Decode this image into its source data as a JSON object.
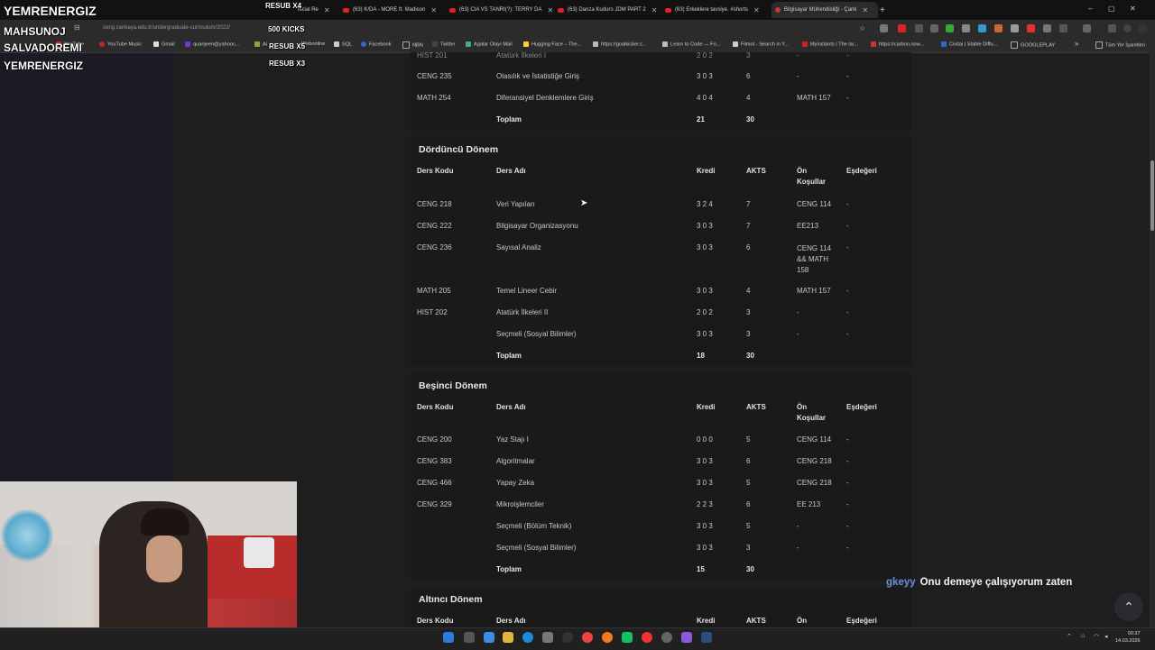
{
  "browser": {
    "tabs": [
      {
        "label": "fficial Re",
        "icon": "youtube-icon"
      },
      {
        "label": "(63) K/DA - MORE ft. Madison",
        "icon": "youtube-icon"
      },
      {
        "label": "(63) CIA VS TANRI(?): TERRY DA",
        "icon": "youtube-icon"
      },
      {
        "label": "(63) Danza Kuduro JDM PART 2",
        "icon": "youtube-icon"
      },
      {
        "label": "(63) Erkeklere tavsiye. #shorts",
        "icon": "youtube-icon"
      },
      {
        "label": "Bilgisayar Mühendisliği - Çank",
        "icon": "university-icon"
      }
    ],
    "address": "ceng.cankaya.edu.tr/undergraduate-curriculum/2022/",
    "bookmarks": [
      "YouTube",
      "YouTube Music",
      "Gmail",
      "quanjeen@yahooc...",
      "Ai",
      "Webonline",
      "SQL",
      "Facebook",
      "NBN",
      "Twitter",
      "Agalar Olayı Mail",
      "Hugging Face – The...",
      "https://goalkicker.c...",
      "Learn to Code — Fo...",
      "Filmot - Search in Y...",
      "Myinstants | The lar...",
      "https://carbon.now...",
      "Civitai | Stable Diffu...",
      "GOOGLEPLAY"
    ],
    "bookmarks_more": "»",
    "all_bookmarks": "Tüm Yer İşaretleri"
  },
  "overlay": {
    "main_name": "YEMRENERGIZ",
    "names": [
      "MAHSUNOJ",
      "SALVADOREMI",
      "YEMRENERGIZ"
    ],
    "labels": [
      "RESUB X4",
      "500 KICKS",
      "RESUB X5",
      "RESUB X3"
    ]
  },
  "curriculum": {
    "headers": {
      "code": "Ders Kodu",
      "name": "Ders Adı",
      "credit": "Kredi",
      "ects": "AKTS",
      "prereq": "Ön Koşullar",
      "equiv": "Eşdeğeri"
    },
    "prereq_cut": "Ön",
    "total_label": "Toplam",
    "third": {
      "rows": [
        {
          "code": "HIST 201",
          "name": "Atatürk İlkeleri I",
          "credit": "2 0 2",
          "ects": "3",
          "prereq": "-",
          "equiv": "-"
        },
        {
          "code": "CENG 235",
          "name": "Olasılık ve İstatistiğe Giriş",
          "credit": "3 0 3",
          "ects": "6",
          "prereq": "-",
          "equiv": "-"
        },
        {
          "code": "MATH 254",
          "name": "Diferansiyel Denklemlere Giriş",
          "credit": "4 0 4",
          "ects": "4",
          "prereq": "MATH 157",
          "equiv": "-"
        }
      ],
      "total_credit": "21",
      "total_ects": "30"
    },
    "fourth": {
      "title": "Dördüncü Dönem",
      "rows": [
        {
          "code": "CENG 218",
          "name": "Veri Yapıları",
          "credit": "3 2 4",
          "ects": "7",
          "prereq": "CENG 114",
          "equiv": "-"
        },
        {
          "code": "CENG 222",
          "name": "Bilgisayar Organizasyonu",
          "credit": "3 0 3",
          "ects": "7",
          "prereq": "EE213",
          "equiv": "-"
        },
        {
          "code": "CENG 236",
          "name": "Sayısal Analiz",
          "credit": "3 0 3",
          "ects": "6",
          "prereq": "CENG 114 && MATH 158",
          "equiv": "-"
        },
        {
          "code": "MATH 205",
          "name": "Temel Lineer Cebir",
          "credit": "3 0 3",
          "ects": "4",
          "prereq": "MATH 157",
          "equiv": "-"
        },
        {
          "code": "HIST 202",
          "name": "Atatürk İlkeleri II",
          "credit": "2 0 2",
          "ects": "3",
          "prereq": "-",
          "equiv": "-"
        },
        {
          "code": "",
          "name": "Seçmeli (Sosyal Bilimler)",
          "credit": "3 0 3",
          "ects": "3",
          "prereq": "-",
          "equiv": "-"
        }
      ],
      "total_credit": "18",
      "total_ects": "30"
    },
    "fifth": {
      "title": "Beşinci Dönem",
      "rows": [
        {
          "code": "CENG 200",
          "name": "Yaz Stajı I",
          "credit": "0 0 0",
          "ects": "5",
          "prereq": "CENG 114",
          "equiv": "-"
        },
        {
          "code": "CENG 383",
          "name": "Algoritmalar",
          "credit": "3 0 3",
          "ects": "6",
          "prereq": "CENG 218",
          "equiv": "-"
        },
        {
          "code": "CENG 466",
          "name": "Yapay Zeka",
          "credit": "3 0 3",
          "ects": "5",
          "prereq": "CENG 218",
          "equiv": "-"
        },
        {
          "code": "CENG 329",
          "name": "Mikroişlemciler",
          "credit": "2 2 3",
          "ects": "6",
          "prereq": "EE 213",
          "equiv": "-"
        },
        {
          "code": "",
          "name": "Seçmeli (Bölüm Teknik)",
          "credit": "3 0 3",
          "ects": "5",
          "prereq": "-",
          "equiv": "-"
        },
        {
          "code": "",
          "name": "Seçmeli (Sosyal Bilimler)",
          "credit": "3 0 3",
          "ects": "3",
          "prereq": "-",
          "equiv": "-"
        }
      ],
      "total_credit": "15",
      "total_ects": "30"
    },
    "sixth": {
      "title": "Altıncı Dönem"
    }
  },
  "chat": {
    "user": "gkeyy",
    "message": "Onu demeye çalışıyorum zaten"
  },
  "clock": {
    "time": "00:37",
    "date": "14.03.2026"
  },
  "colors": {
    "accent_user": "#6d8fd6",
    "background": "#1e1e1f",
    "card": "#1a1a1a"
  }
}
